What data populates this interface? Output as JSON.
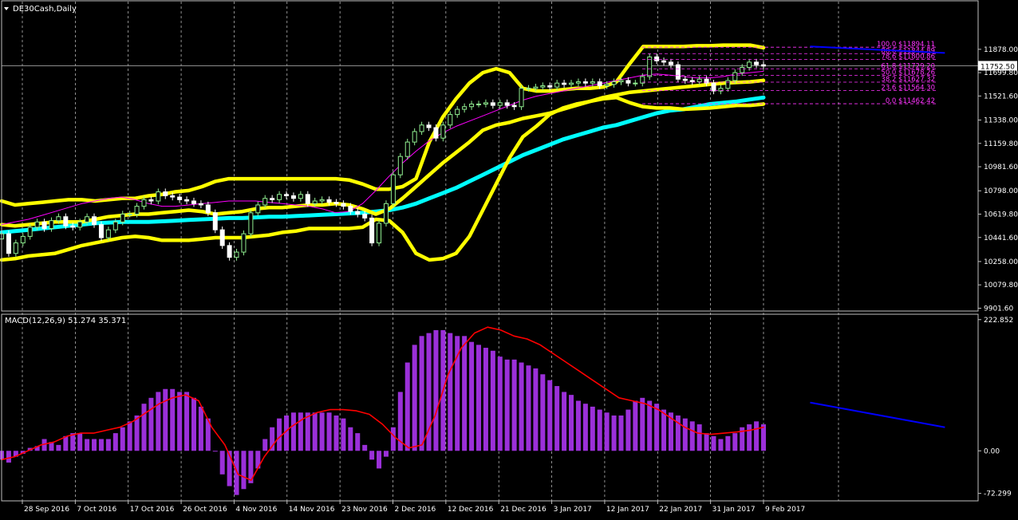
{
  "header": {
    "symbol_label": "DE30Cash,Daily"
  },
  "colors": {
    "background": "#000000",
    "frame": "#c0c0c0",
    "text": "#ffffff",
    "grid": "#ffffff",
    "bull_candle": "#90ee90",
    "bear_candle": "#ffffff",
    "bollinger": "#ffff00",
    "long_ma": "#00ffff",
    "short_ma": "#ff00ff",
    "fib": "#ff33ff",
    "trendline": "#0000ff",
    "macd_hist": "#9b30d9",
    "macd_signal": "#ff0000",
    "current_price_box": "#ffffff"
  },
  "chart_data": [
    {
      "type": "line",
      "title": "DE30Cash,Daily",
      "y_ticks": [
        11878.0,
        11699.8,
        11521.6,
        11338.0,
        11159.8,
        10981.6,
        10798.0,
        10619.8,
        10441.6,
        10258.0,
        10079.8,
        9901.6
      ],
      "y_tick_labels": [
        "11878.00",
        "11699.80",
        "11521.60",
        "11338.00",
        "11159.80",
        "10981.60",
        "10798.00",
        "10619.80",
        "10441.60",
        "10258.00",
        "10079.80",
        "9901.60"
      ],
      "ylim": [
        9880,
        12230
      ],
      "current_price": 11752.5,
      "current_price_label": "11752.50",
      "x_labels": [
        "28 Sep 2016",
        "7 Oct 2016",
        "17 Oct 2016",
        "26 Oct 2016",
        "4 Nov 2016",
        "14 Nov 2016",
        "23 Nov 2016",
        "2 Dec 2016",
        "12 Dec 2016",
        "21 Dec 2016",
        "3 Jan 2017",
        "12 Jan 2017",
        "22 Jan 2017",
        "31 Jan 2017",
        "9 Feb 2017"
      ],
      "grid": "vertical dashed at date labels",
      "closes": [
        10470,
        10320,
        10400,
        10450,
        10520,
        10560,
        10510,
        10570,
        10600,
        10530,
        10520,
        10560,
        10600,
        10540,
        10440,
        10500,
        10560,
        10620,
        10620,
        10680,
        10730,
        10720,
        10790,
        10760,
        10750,
        10730,
        10720,
        10700,
        10690,
        10630,
        10500,
        10380,
        10290,
        10330,
        10470,
        10630,
        10690,
        10740,
        10730,
        10770,
        10760,
        10740,
        10770,
        10700,
        10720,
        10730,
        10710,
        10700,
        10680,
        10640,
        10620,
        10590,
        10400,
        10550,
        10700,
        10920,
        11060,
        11170,
        11250,
        11300,
        11280,
        11200,
        11300,
        11380,
        11420,
        11440,
        11460,
        11460,
        11470,
        11450,
        11470,
        11450,
        11440,
        11580,
        11580,
        11590,
        11600,
        11590,
        11620,
        11610,
        11620,
        11630,
        11620,
        11630,
        11600,
        11610,
        11630,
        11640,
        11620,
        11620,
        11670,
        11820,
        11790,
        11780,
        11760,
        11650,
        11640,
        11630,
        11650,
        11620,
        11560,
        11580,
        11640,
        11700,
        11740,
        11780,
        11760,
        11750
      ],
      "bollinger_upper": [
        10720,
        10690,
        10700,
        10710,
        10720,
        10730,
        10730,
        10720,
        10730,
        10740,
        10740,
        10760,
        10770,
        10790,
        10800,
        10830,
        10870,
        10890,
        10890,
        10890,
        10890,
        10890,
        10890,
        10890,
        10890,
        10890,
        10880,
        10850,
        10810,
        10810,
        10830,
        10890,
        11170,
        11360,
        11500,
        11620,
        11700,
        11730,
        11700,
        11580,
        11560,
        11560,
        11570,
        11580,
        11580,
        11590,
        11630,
        11770,
        11900,
        11900,
        11900,
        11900,
        11905,
        11905,
        11910,
        11910,
        11910,
        11890
      ],
      "bollinger_middle": [
        10540,
        10530,
        10540,
        10550,
        10560,
        10560,
        10560,
        10580,
        10600,
        10610,
        10620,
        10620,
        10630,
        10640,
        10650,
        10640,
        10620,
        10630,
        10640,
        10660,
        10670,
        10670,
        10680,
        10690,
        10690,
        10700,
        10690,
        10660,
        10620,
        10660,
        10740,
        10830,
        10920,
        11010,
        11090,
        11170,
        11260,
        11300,
        11320,
        11350,
        11370,
        11390,
        11420,
        11450,
        11480,
        11510,
        11530,
        11550,
        11560,
        11570,
        11580,
        11590,
        11600,
        11610,
        11620,
        11625,
        11630,
        11640
      ],
      "bollinger_lower": [
        10270,
        10280,
        10300,
        10310,
        10320,
        10350,
        10380,
        10400,
        10420,
        10440,
        10450,
        10440,
        10420,
        10420,
        10420,
        10430,
        10440,
        10440,
        10440,
        10450,
        10460,
        10480,
        10490,
        10510,
        10510,
        10510,
        10510,
        10520,
        10580,
        10570,
        10480,
        10320,
        10270,
        10280,
        10320,
        10450,
        10650,
        10850,
        11050,
        11210,
        11290,
        11380,
        11430,
        11460,
        11480,
        11500,
        11510,
        11470,
        11440,
        11430,
        11430,
        11420,
        11425,
        11430,
        11440,
        11450,
        11450,
        11460
      ],
      "long_ma": [
        10480,
        10490,
        10500,
        10510,
        10520,
        10530,
        10540,
        10550,
        10555,
        10560,
        10560,
        10560,
        10565,
        10570,
        10575,
        10580,
        10585,
        10590,
        10590,
        10595,
        10600,
        10600,
        10605,
        10610,
        10615,
        10620,
        10625,
        10630,
        10640,
        10650,
        10670,
        10700,
        10740,
        10780,
        10820,
        10870,
        10920,
        10970,
        11020,
        11070,
        11110,
        11150,
        11190,
        11220,
        11250,
        11280,
        11300,
        11330,
        11360,
        11390,
        11410,
        11420,
        11440,
        11460,
        11470,
        11480,
        11495,
        11510
      ],
      "short_ma": [
        10540,
        10560,
        10580,
        10610,
        10640,
        10670,
        10700,
        10720,
        10740,
        10750,
        10730,
        10700,
        10680,
        10680,
        10690,
        10700,
        10710,
        10720,
        10720,
        10720,
        10710,
        10700,
        10690,
        10680,
        10660,
        10630,
        10640,
        10700,
        10800,
        10910,
        11010,
        11100,
        11180,
        11240,
        11290,
        11330,
        11370,
        11410,
        11450,
        11490,
        11520,
        11540,
        11560,
        11580,
        11600,
        11620,
        11640,
        11660,
        11680,
        11690,
        11680,
        11670,
        11660,
        11660,
        11670,
        11690,
        11700,
        11710
      ],
      "fibonacci": {
        "labels": [
          "100.0 $11894.11",
          "88.6 $11844.89",
          "78.6 $11800.86",
          "61.8 $11729.20",
          "50.0 $11678.26",
          "38.2 $11627.32",
          "23.6 $11564.30",
          "0.0 $11462.42"
        ],
        "values": [
          11894.11,
          11844.89,
          11800.86,
          11729.2,
          11678.26,
          11627.32,
          11564.3,
          11462.42
        ]
      },
      "trendline": {
        "x": [
          0.828,
          0.966
        ],
        "y": [
          11900,
          11850
        ]
      }
    },
    {
      "type": "bar",
      "title": "MACD(12,26,9) 51.274 35.371",
      "y_ticks": [
        222.852,
        0.0,
        -72.299
      ],
      "y_tick_labels": [
        "222.852",
        "0.00",
        "-72.299"
      ],
      "ylim": [
        -85,
        232
      ],
      "histogram": [
        -15,
        -20,
        -10,
        -5,
        5,
        8,
        20,
        15,
        10,
        25,
        30,
        30,
        20,
        20,
        20,
        20,
        30,
        40,
        50,
        60,
        80,
        90,
        100,
        105,
        105,
        100,
        100,
        90,
        75,
        55,
        0,
        -40,
        -60,
        -75,
        -65,
        -55,
        -30,
        20,
        40,
        55,
        60,
        65,
        65,
        65,
        65,
        65,
        65,
        60,
        55,
        40,
        30,
        10,
        -15,
        -30,
        -10,
        40,
        100,
        150,
        180,
        195,
        200,
        205,
        205,
        200,
        195,
        195,
        185,
        180,
        175,
        170,
        160,
        155,
        155,
        150,
        145,
        140,
        130,
        120,
        110,
        100,
        95,
        85,
        80,
        75,
        70,
        65,
        60,
        60,
        70,
        85,
        90,
        85,
        80,
        70,
        65,
        60,
        55,
        50,
        45,
        30,
        25,
        20,
        25,
        30,
        40,
        45,
        50,
        45
      ],
      "signal": [
        -15,
        -10,
        0,
        10,
        15,
        25,
        30,
        30,
        35,
        40,
        50,
        65,
        80,
        90,
        95,
        85,
        40,
        10,
        -40,
        -50,
        -10,
        20,
        40,
        55,
        65,
        70,
        70,
        68,
        62,
        45,
        22,
        5,
        10,
        60,
        130,
        175,
        200,
        210,
        205,
        195,
        190,
        180,
        165,
        150,
        135,
        120,
        105,
        90,
        85,
        80,
        70,
        55,
        40,
        30,
        28,
        30,
        32,
        35,
        40
      ],
      "trendline": {
        "x": [
          0.828,
          0.966
        ],
        "y": [
          82,
          40
        ]
      }
    }
  ]
}
